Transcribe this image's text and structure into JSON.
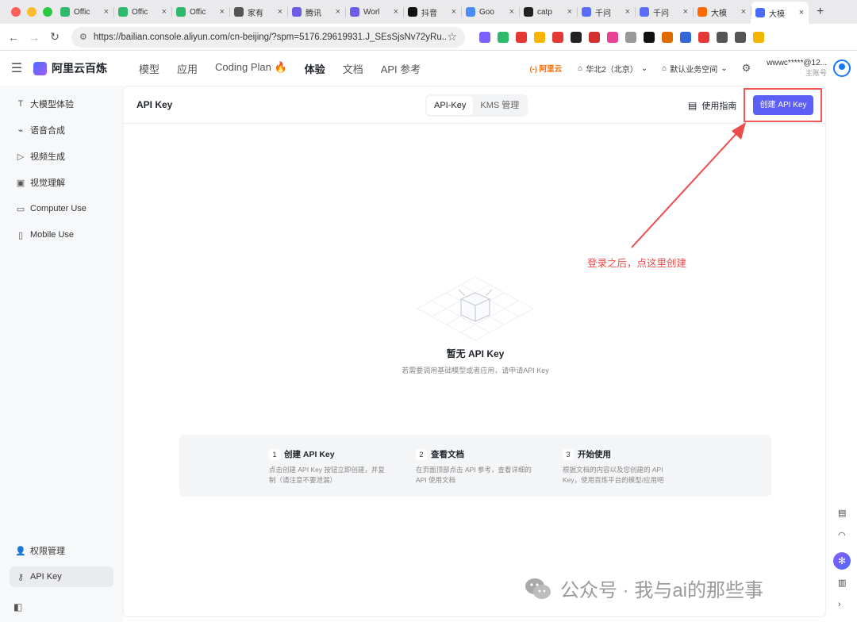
{
  "browser": {
    "tabs": [
      {
        "title": "Offic",
        "color": "#2fb96b"
      },
      {
        "title": "Offic",
        "color": "#2fb96b"
      },
      {
        "title": "Offic",
        "color": "#2fb96b"
      },
      {
        "title": "家有",
        "color": "#555555"
      },
      {
        "title": "腾讯",
        "color": "#6c5ce7"
      },
      {
        "title": "Worl",
        "color": "#6c5ce7"
      },
      {
        "title": "抖音",
        "color": "#111111"
      },
      {
        "title": "Goo",
        "color": "#4b8bf5"
      },
      {
        "title": "catp",
        "color": "#222222"
      },
      {
        "title": "千问",
        "color": "#5b6cff"
      },
      {
        "title": "千问",
        "color": "#5b6cff"
      },
      {
        "title": "大模",
        "color": "#ff6a00"
      },
      {
        "title": "大模",
        "color": "#4c6bff"
      }
    ],
    "tab_close": "×",
    "new_tab": "+",
    "url": "https://bailian.console.aliyun.com/cn-beijing/?spm=5176.29619931.J_SEsSjsNv72yRu...",
    "ext_colors": [
      "#7b61ff",
      "#2fb96b",
      "#e53935",
      "#f9b400",
      "#e53935",
      "#222222",
      "#d32f2f",
      "#e84393",
      "#999999",
      "#111111",
      "#e06b00",
      "#3367d6",
      "#e53935",
      "#555555",
      "#555555",
      "#f2b600"
    ]
  },
  "header": {
    "brand": "阿里云百炼",
    "nav": [
      {
        "label": "模型",
        "active": false
      },
      {
        "label": "应用",
        "active": false
      },
      {
        "label": "Coding Plan 🔥",
        "active": false
      },
      {
        "label": "体验",
        "active": true
      },
      {
        "label": "文档",
        "active": false
      },
      {
        "label": "API 参考",
        "active": false
      }
    ],
    "aliyun": "(-) 阿里云",
    "region": "华北2（北京）",
    "workspace": "默认业务空间",
    "account": "wwwc*****@12...",
    "account_sub": "主账号"
  },
  "sidebar": {
    "items": [
      {
        "label": "大模型体验",
        "icon": "T"
      },
      {
        "label": "语音合成",
        "icon": "⌁"
      },
      {
        "label": "视频生成",
        "icon": "▷"
      },
      {
        "label": "视觉理解",
        "icon": "▣"
      },
      {
        "label": "Computer Use",
        "icon": "▭"
      },
      {
        "label": "Mobile Use",
        "icon": "▯"
      }
    ],
    "bottom_items": [
      {
        "label": "权限管理",
        "icon": "👤",
        "active": false
      },
      {
        "label": "API Key",
        "icon": "⚷",
        "active": true
      }
    ]
  },
  "main": {
    "title": "API Key",
    "segments": [
      {
        "label": "API-Key",
        "active": true
      },
      {
        "label": "KMS 管理",
        "active": false
      }
    ],
    "guide": "使用指南",
    "create_button": "创建 API Key",
    "empty_title": "暂无 API Key",
    "empty_sub": "若需要调用基础模型或者应用，请申请API Key",
    "steps": [
      {
        "num": "1",
        "title": "创建 API Key",
        "desc": "点击创建 API Key 按钮立即创建，并复制（请注意不要泄漏）"
      },
      {
        "num": "2",
        "title": "查看文档",
        "desc": "在页面顶部点击 API 参考，查看详细的 API 使用文档"
      },
      {
        "num": "3",
        "title": "开始使用",
        "desc": "根据文档的内容以及您创建的 API Key，使用百炼平台的模型/应用吧"
      }
    ]
  },
  "annotation": {
    "text": "登录之后，点这里创建",
    "color": "#ea4b4b"
  },
  "watermark": {
    "text": "公众号 · 我与ai的那些事"
  },
  "colors": {
    "primary": "#5b5ff5",
    "highlight": "#f25656"
  }
}
